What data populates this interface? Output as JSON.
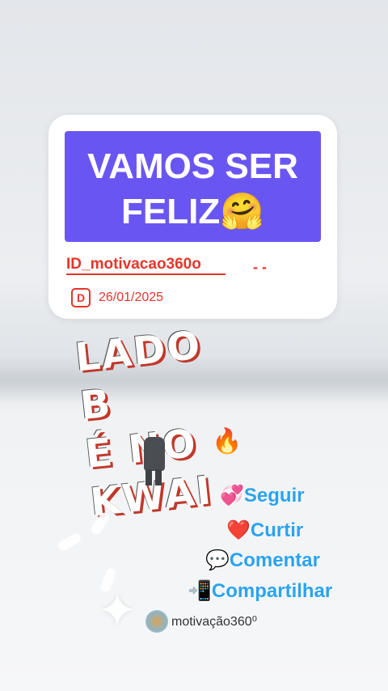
{
  "card": {
    "title_line1": "VAMOS SER",
    "title_line2": "FELIZ",
    "title_emoji": "🤗",
    "id_text": "ID_motivacao360o",
    "id_dash": "- -",
    "badge_letter": "D",
    "date": "26/01/2025"
  },
  "logo": {
    "line1": "LADO B",
    "line2": "É NO KWAI"
  },
  "fire_emoji": "🔥",
  "actions": [
    {
      "emoji": "💞",
      "label": "Seguir"
    },
    {
      "emoji": "❤️",
      "label": "Curtir"
    },
    {
      "emoji": "💬",
      "label": "Comentar"
    },
    {
      "emoji": "📲",
      "label": "Compartilhar"
    }
  ],
  "author": {
    "handle": "motivação360⁰"
  },
  "colors": {
    "title_box": "#6956f2",
    "accent_red": "#e4362a",
    "cta_blue": "#2aa3f0"
  }
}
